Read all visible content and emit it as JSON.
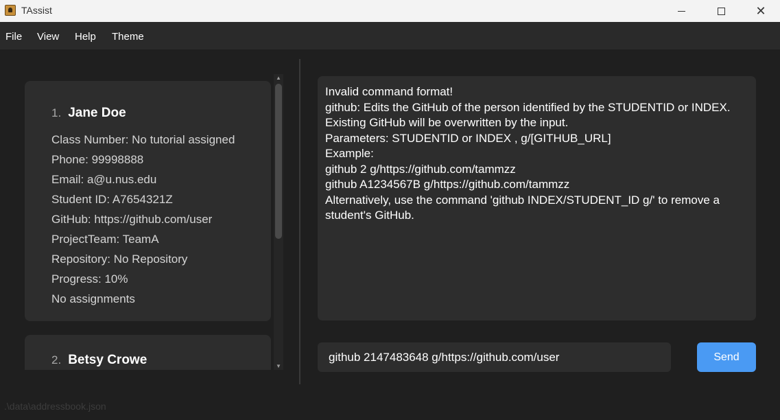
{
  "window": {
    "title": "TAssist",
    "minimize_label": "",
    "maximize_label": "",
    "close_label": "✕"
  },
  "menu": {
    "items": [
      "File",
      "View",
      "Help",
      "Theme"
    ]
  },
  "persons": [
    {
      "index": "1.",
      "name": "Jane Doe",
      "fields": [
        "Class Number: No tutorial assigned",
        "Phone: 99998888",
        "Email: a@u.nus.edu",
        "Student ID: A7654321Z",
        "GitHub: https://github.com/user",
        "ProjectTeam: TeamA",
        "Repository: No Repository",
        "Progress: 10%",
        "No assignments"
      ]
    },
    {
      "index": "2.",
      "name": "Betsy Crowe",
      "fields": []
    }
  ],
  "result": {
    "lines": [
      "Invalid command format!",
      "github: Edits the GitHub of the person identified by the STUDENTID or INDEX.",
      "Existing GitHub will be overwritten by the input.",
      "Parameters: STUDENTID or INDEX , g/[GITHUB_URL]",
      "Example:",
      "github 2 g/https://github.com/tammzz",
      "github A1234567B g/https://github.com/tammzz",
      "Alternatively, use the command 'github INDEX/STUDENT_ID g/' to remove a",
      "student's GitHub."
    ]
  },
  "command": {
    "value": "github 2147483648 g/https://github.com/user",
    "send_label": "Send"
  },
  "status": {
    "file_path": ".\\data\\addressbook.json"
  },
  "colors": {
    "background": "#1f1f1f",
    "card": "#2d2d2d",
    "accent": "#4a9af3",
    "titlebar": "#f3f3f3"
  }
}
